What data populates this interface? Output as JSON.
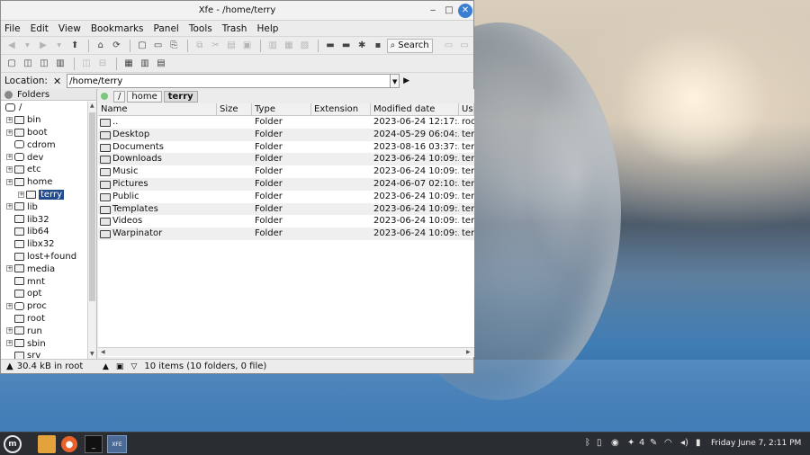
{
  "window": {
    "title": "Xfe - /home/terry"
  },
  "menubar": [
    "File",
    "Edit",
    "View",
    "Bookmarks",
    "Panel",
    "Tools",
    "Trash",
    "Help"
  ],
  "toolbar": {
    "search_label": "Search"
  },
  "location": {
    "label": "Location:",
    "clear": "✕",
    "value": "/home/terry"
  },
  "left_panel": {
    "header": "Folders",
    "root": "/",
    "items": [
      {
        "label": "bin"
      },
      {
        "label": "boot"
      },
      {
        "label": "cdrom"
      },
      {
        "label": "dev"
      },
      {
        "label": "etc"
      },
      {
        "label": "home"
      },
      {
        "label": "terry"
      },
      {
        "label": "lib"
      },
      {
        "label": "lib32"
      },
      {
        "label": "lib64"
      },
      {
        "label": "libx32"
      },
      {
        "label": "lost+found"
      },
      {
        "label": "media"
      },
      {
        "label": "mnt"
      },
      {
        "label": "opt"
      },
      {
        "label": "proc"
      },
      {
        "label": "root"
      },
      {
        "label": "run"
      },
      {
        "label": "sbin"
      },
      {
        "label": "srv"
      }
    ]
  },
  "breadcrumbs": [
    "/",
    "home",
    "terry"
  ],
  "filelist": {
    "columns": [
      "Name",
      "Size",
      "Type",
      "Extension",
      "Modified date",
      "Us"
    ],
    "rows": [
      {
        "name": "..",
        "size": "",
        "type": "Folder",
        "ext": "",
        "modified": "2023-06-24 12:17:...",
        "user": "roo"
      },
      {
        "name": "Desktop",
        "size": "",
        "type": "Folder",
        "ext": "",
        "modified": "2024-05-29 06:04:...",
        "user": "ter"
      },
      {
        "name": "Documents",
        "size": "",
        "type": "Folder",
        "ext": "",
        "modified": "2023-08-16 03:37:...",
        "user": "ter"
      },
      {
        "name": "Downloads",
        "size": "",
        "type": "Folder",
        "ext": "",
        "modified": "2023-06-24 10:09:...",
        "user": "ter"
      },
      {
        "name": "Music",
        "size": "",
        "type": "Folder",
        "ext": "",
        "modified": "2023-06-24 10:09:...",
        "user": "ter"
      },
      {
        "name": "Pictures",
        "size": "",
        "type": "Folder",
        "ext": "",
        "modified": "2024-06-07 02:10:...",
        "user": "ter"
      },
      {
        "name": "Public",
        "size": "",
        "type": "Folder",
        "ext": "",
        "modified": "2023-06-24 10:09:...",
        "user": "ter"
      },
      {
        "name": "Templates",
        "size": "",
        "type": "Folder",
        "ext": "",
        "modified": "2023-06-24 10:09:...",
        "user": "ter"
      },
      {
        "name": "Videos",
        "size": "",
        "type": "Folder",
        "ext": "",
        "modified": "2023-06-24 10:09:...",
        "user": "ter"
      },
      {
        "name": "Warpinator",
        "size": "",
        "type": "Folder",
        "ext": "",
        "modified": "2023-06-24 10:09:...",
        "user": "ter"
      }
    ]
  },
  "statusbar": {
    "left": "30.4 kB in root",
    "right": "10 items (10 folders, 0 file)"
  },
  "taskbar": {
    "clock": "Friday June  7, 2:11 PM",
    "workspace_count": "4",
    "xfe_label": "XFE"
  },
  "icons": [
    "back-icon",
    "forward-icon",
    "up-icon",
    "home-icon",
    "refresh-icon",
    "new-file-icon",
    "new-folder-icon",
    "copy-icon",
    "cut-icon",
    "paste-icon",
    "delete-icon",
    "search-icon"
  ]
}
